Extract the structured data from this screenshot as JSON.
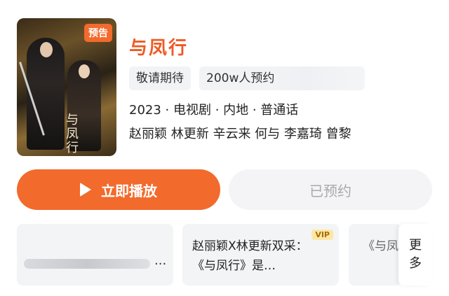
{
  "poster": {
    "badge": "预告",
    "calligraphy": "与凤行"
  },
  "show": {
    "title": "与凤行",
    "chips": [
      "敬请期待",
      "200w人预约"
    ],
    "meta": "2023 · 电视剧 · 内地 · 普通话",
    "cast": "赵丽颖 林更新 辛云来 何与 李嘉琦 曾黎"
  },
  "actions": {
    "play_label": "立即播放",
    "booked_label": "已预约"
  },
  "cards": {
    "card1_suffix": "...",
    "card2_text": "赵丽颖Ⅹ林更新双采：《与凤行》是…",
    "card2_badge": "VIP",
    "card3_text": "《与凤片：赵",
    "more_label": "更多"
  },
  "colors": {
    "accent": "#f26a2c",
    "title": "#f05a24",
    "chip_bg": "#f2f3f5",
    "booked_bg": "#f4f4f6",
    "vip_bg": "#fde7a7"
  }
}
